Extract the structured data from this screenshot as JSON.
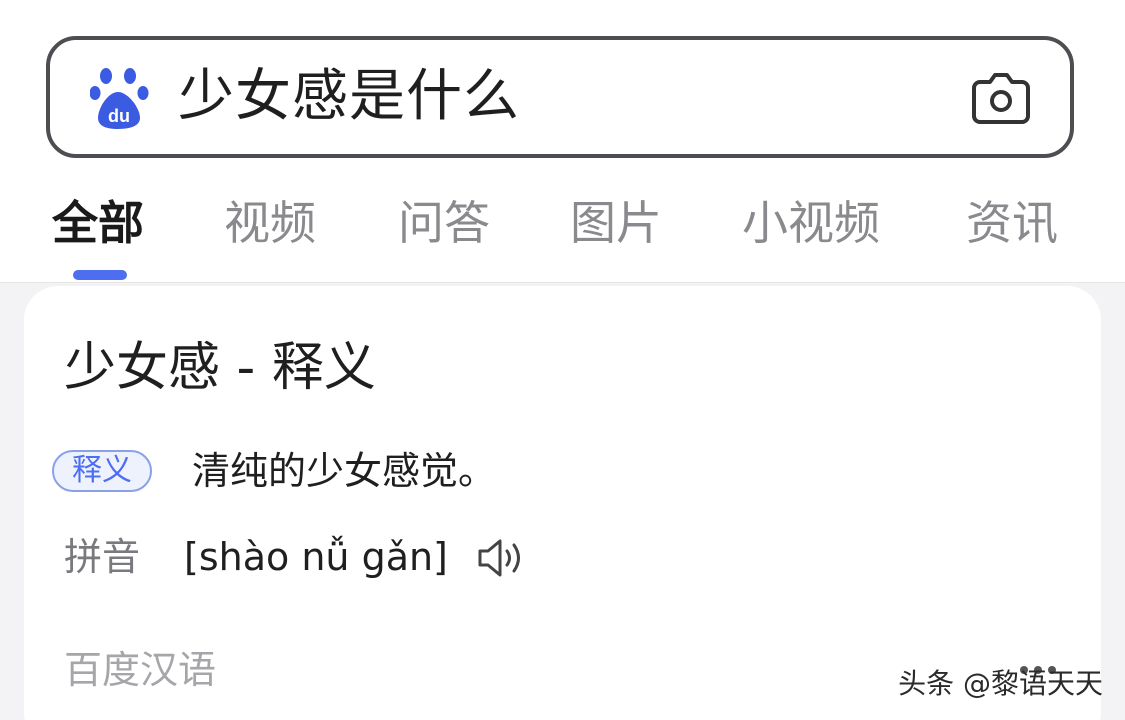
{
  "search": {
    "query": "少女感是什么",
    "logo_icon": "baidu-paw-logo",
    "camera_icon": "camera-icon"
  },
  "tabs": [
    {
      "label": "全部",
      "active": true
    },
    {
      "label": "视频",
      "active": false
    },
    {
      "label": "问答",
      "active": false
    },
    {
      "label": "图片",
      "active": false
    },
    {
      "label": "小视频",
      "active": false
    },
    {
      "label": "资讯",
      "active": false
    }
  ],
  "card": {
    "title": "少女感 - 释义",
    "definition_badge": "释义",
    "definition_text": "清纯的少女感觉。",
    "pinyin_label": "拼音",
    "pinyin_value": "[shào nǚ gǎn]",
    "speaker_icon": "speaker-icon",
    "source": "百度汉语"
  },
  "watermark": {
    "text": "头条 @黎语天天"
  },
  "colors": {
    "accent": "#4e6ef2",
    "search_border": "#4e4e52",
    "tab_inactive": "#8a8a8e",
    "background": "#f3f3f5"
  }
}
